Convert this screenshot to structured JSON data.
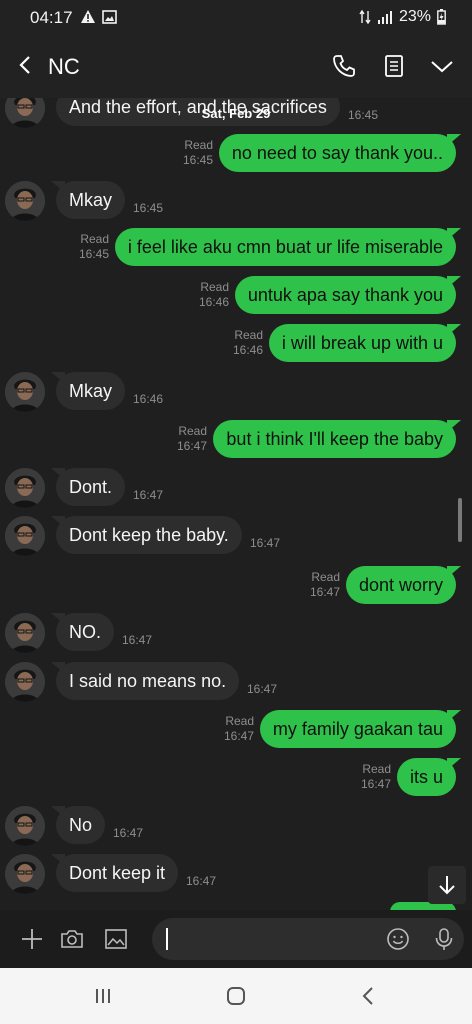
{
  "status": {
    "time": "04:17",
    "battery": "23%"
  },
  "header": {
    "contact_name": "NC"
  },
  "chat": {
    "date_separator": "Sat, Feb 29",
    "messages": [
      {
        "dir": "in",
        "text": "And the effort, and the sacrifices",
        "time": "16:45"
      },
      {
        "dir": "out",
        "text": "no need to say thank you..",
        "read": "Read",
        "time": "16:45"
      },
      {
        "dir": "in",
        "text": "Mkay",
        "time": "16:45"
      },
      {
        "dir": "out",
        "text": "i feel like aku cmn buat ur life miserable",
        "read": "Read",
        "time": "16:45"
      },
      {
        "dir": "out",
        "text": "untuk apa say thank you",
        "read": "Read",
        "time": "16:46"
      },
      {
        "dir": "out",
        "text": "i will break up with u",
        "read": "Read",
        "time": "16:46"
      },
      {
        "dir": "in",
        "text": "Mkay",
        "time": "16:46"
      },
      {
        "dir": "out",
        "text": "but i think I'll keep the baby",
        "read": "Read",
        "time": "16:47"
      },
      {
        "dir": "in",
        "text": "Dont.",
        "time": "16:47"
      },
      {
        "dir": "in",
        "text": "Dont keep the baby.",
        "time": "16:47"
      },
      {
        "dir": "out",
        "text": "dont worry",
        "read": "Read",
        "time": "16:47"
      },
      {
        "dir": "in",
        "text": "NO.",
        "time": "16:47"
      },
      {
        "dir": "in",
        "text": "I said no means no.",
        "time": "16:47"
      },
      {
        "dir": "out",
        "text": "my family gaakan tau",
        "read": "Read",
        "time": "16:47"
      },
      {
        "dir": "out",
        "text": "its u",
        "read": "Read",
        "time": "16:47"
      },
      {
        "dir": "in",
        "text": "No",
        "time": "16:47"
      },
      {
        "dir": "in",
        "text": "Dont keep it",
        "time": "16:47"
      }
    ]
  },
  "colors": {
    "outgoing_bubble": "#2fc24a",
    "incoming_bubble": "#2d2d2d",
    "background": "#1f1f1f"
  },
  "icons": {
    "header": [
      "back-chevron-icon",
      "phone-icon",
      "note-icon",
      "chevron-down-icon"
    ],
    "composer": [
      "plus-icon",
      "camera-icon",
      "image-icon",
      "emoji-icon",
      "microphone-icon"
    ],
    "navbar": [
      "recent-apps-icon",
      "home-icon",
      "back-icon"
    ]
  }
}
